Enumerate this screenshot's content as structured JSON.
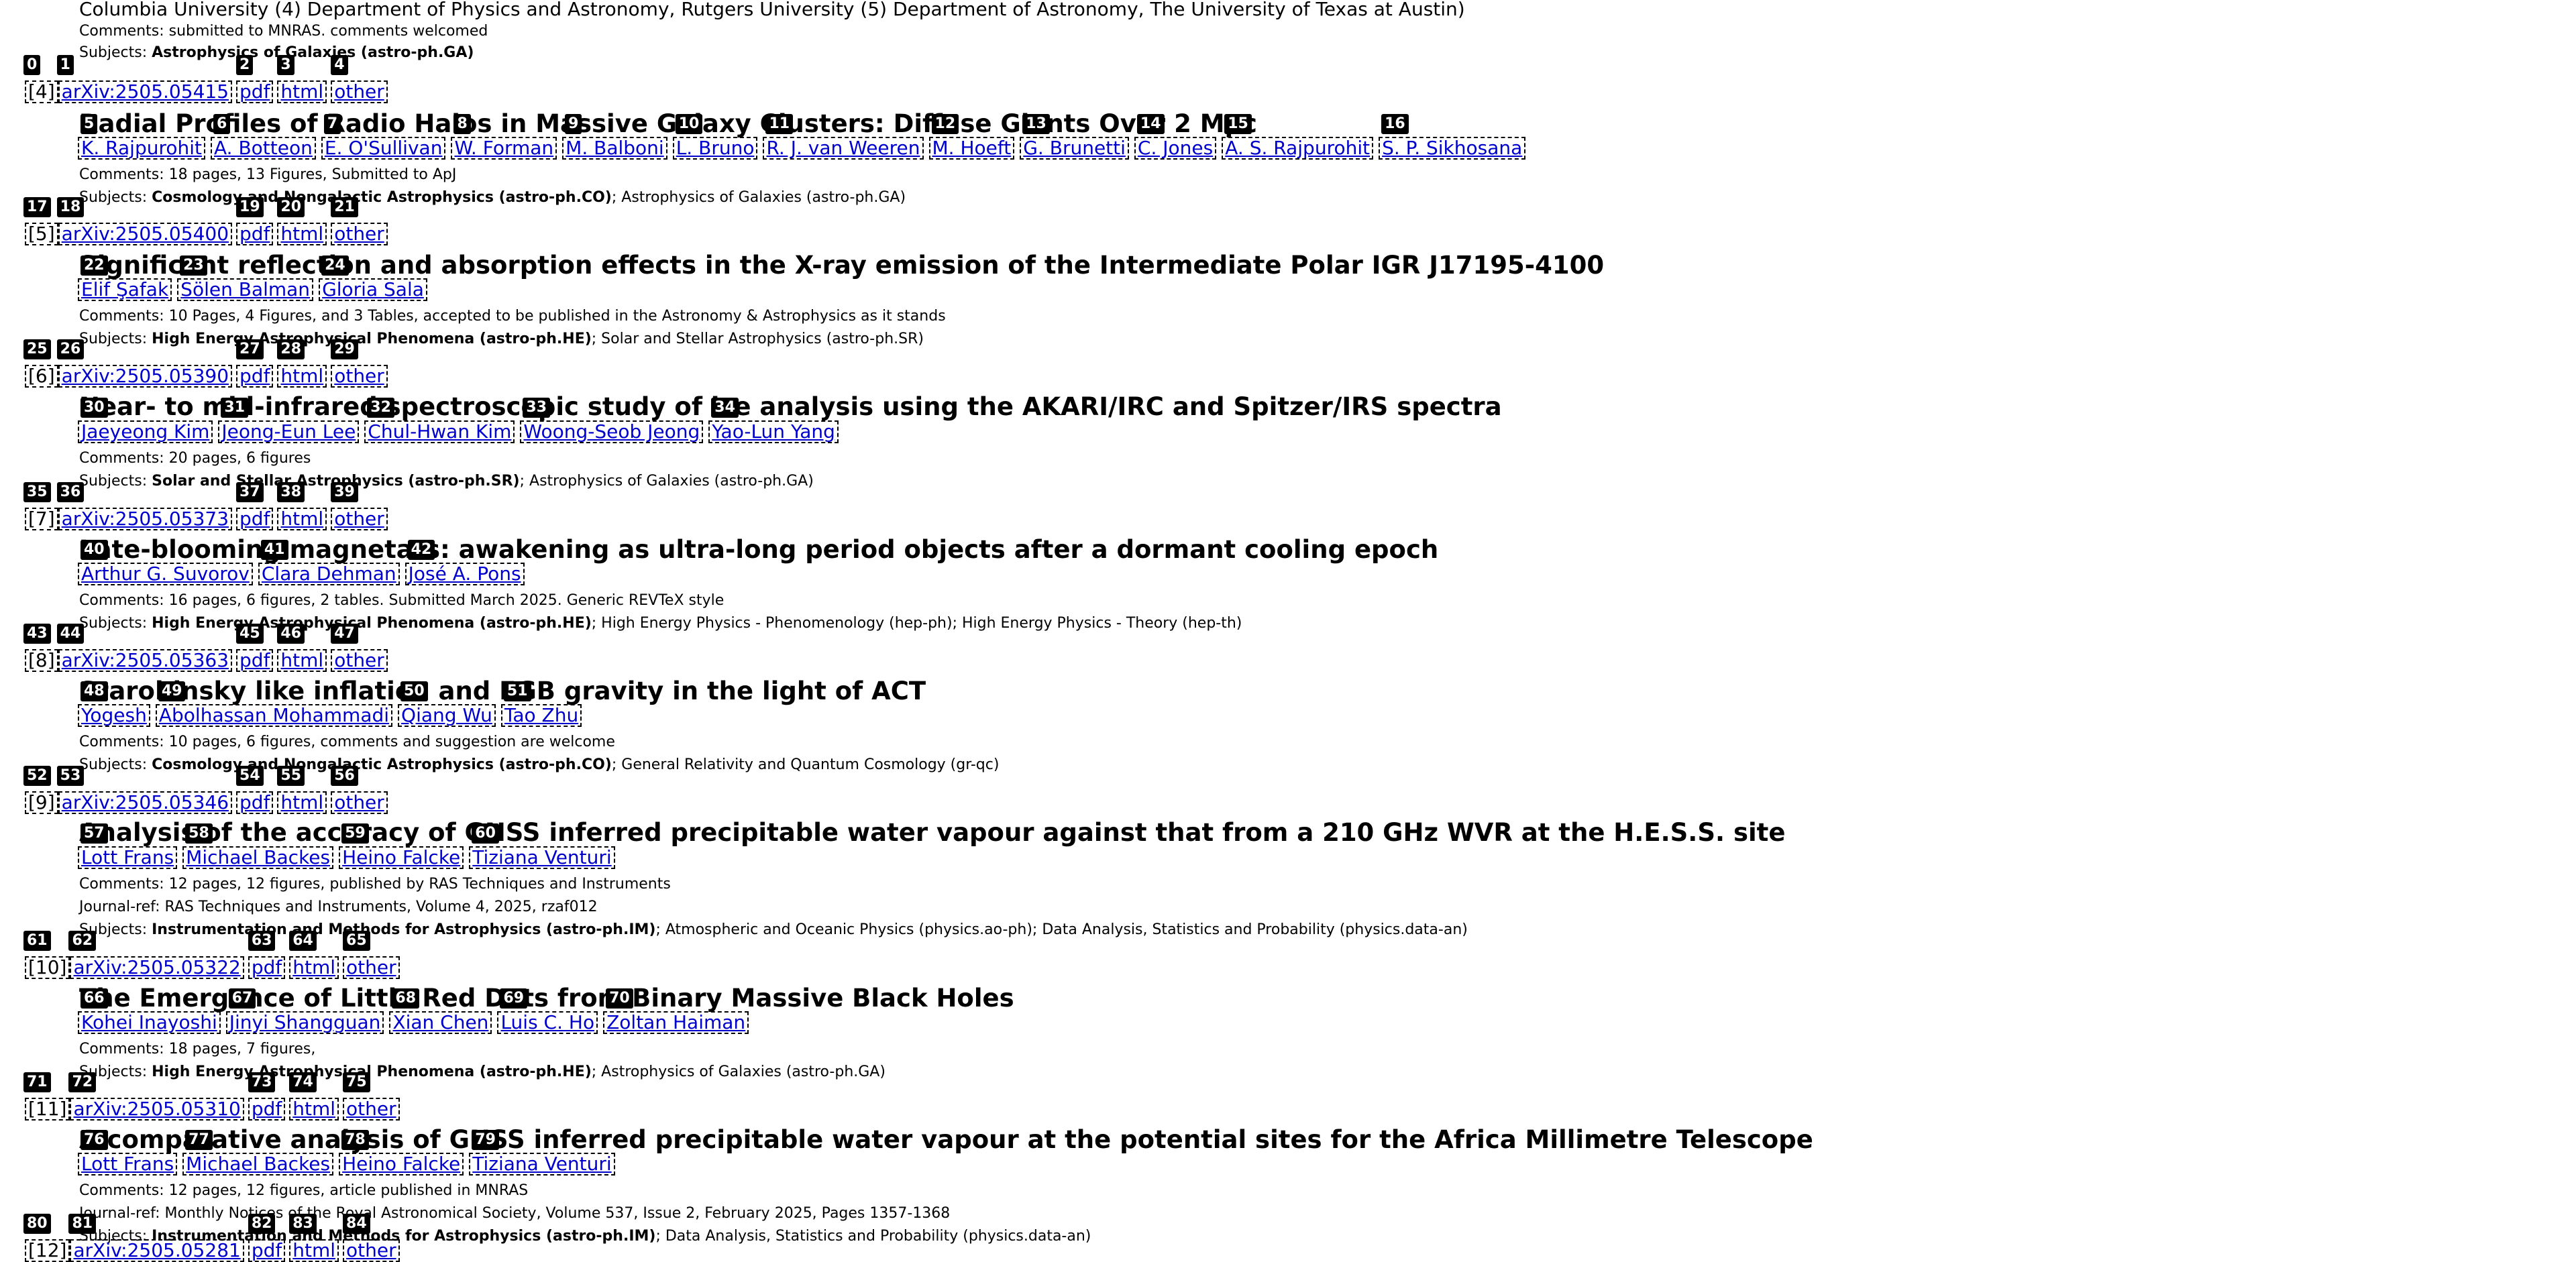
{
  "header_text": {
    "affiliations": "Columbia University (4) Department of Physics and Astronomy, Rutgers University (5) Department of Astronomy, The University of Texas at Austin)",
    "comments": "Comments: submitted to MNRAS. comments welcomed",
    "subjects_prefix": "Subjects: ",
    "subjects_primary": "Astrophysics of Galaxies (astro-ph.GA)"
  },
  "entries": [
    {
      "index": "[4]",
      "arxiv_id": "arXiv:2505.05415",
      "pdf": "pdf",
      "html": "html",
      "other": "other",
      "title": "Radial Profiles of Radio Halos in Massive Galaxy Clusters: Diffuse Giants Over 2 Mpc",
      "authors": [
        "K. Rajpurohit",
        "A. Botteon",
        "E. O'Sullivan",
        "W. Forman",
        "M. Balboni",
        "L. Bruno",
        "R. J. van Weeren",
        "M. Hoeft",
        "G. Brunetti",
        "C. Jones",
        "A. S. Rajpurohit",
        "S. P. Sikhosana"
      ],
      "comments": "Comments: 18 pages, 13 Figures, Submitted to ApJ",
      "subjects_primary": "Cosmology and Nongalactic Astrophysics (astro-ph.CO)",
      "subjects_rest": "; Astrophysics of Galaxies (astro-ph.GA)"
    },
    {
      "index": "[5]",
      "arxiv_id": "arXiv:2505.05400",
      "pdf": "pdf",
      "html": "html",
      "other": "other",
      "title": "Significant reflection and absorption effects in the X-ray emission of the Intermediate Polar IGR J17195-4100",
      "authors": [
        "Elif Şafak",
        "Sölen Balman",
        "Gloria Sala"
      ],
      "comments": "Comments: 10 Pages, 4 Figures, and 3 Tables, accepted to be published in the Astronomy & Astrophysics as it stands",
      "subjects_primary": "High Energy Astrophysical Phenomena (astro-ph.HE)",
      "subjects_rest": "; Solar and Stellar Astrophysics (astro-ph.SR)"
    },
    {
      "index": "[6]",
      "arxiv_id": "arXiv:2505.05390",
      "pdf": "pdf",
      "html": "html",
      "other": "other",
      "title": "Near- to mid-infrared spectroscopic study of ice analysis using the AKARI/IRC and Spitzer/IRS spectra",
      "authors": [
        "Jaeyeong Kim",
        "Jeong-Eun Lee",
        "Chul-Hwan Kim",
        "Woong-Seob Jeong",
        "Yao-Lun Yang"
      ],
      "comments": "Comments: 20 pages, 6 figures",
      "subjects_primary": "Solar and Stellar Astrophysics (astro-ph.SR)",
      "subjects_rest": "; Astrophysics of Galaxies (astro-ph.GA)"
    },
    {
      "index": "[7]",
      "arxiv_id": "arXiv:2505.05373",
      "pdf": "pdf",
      "html": "html",
      "other": "other",
      "title": "Late-blooming magnetars: awakening as ultra-long period objects after a dormant cooling epoch",
      "authors": [
        "Arthur G. Suvorov",
        "Clara Dehman",
        "José A. Pons"
      ],
      "comments": "Comments: 16 pages, 6 figures, 2 tables. Submitted March 2025. Generic REVTeX style",
      "subjects_primary": "High Energy Astrophysical Phenomena (astro-ph.HE)",
      "subjects_rest": "; High Energy Physics - Phenomenology (hep-ph); High Energy Physics - Theory (hep-th)"
    },
    {
      "index": "[8]",
      "arxiv_id": "arXiv:2505.05363",
      "pdf": "pdf",
      "html": "html",
      "other": "other",
      "title": "Starobinsky like inflation and EGB gravity in the light of ACT",
      "authors": [
        "Yogesh",
        "Abolhassan Mohammadi",
        "Qiang Wu",
        "Tao Zhu"
      ],
      "comments": "Comments: 10 pages, 6 figures, comments and suggestion are welcome",
      "subjects_primary": "Cosmology and Nongalactic Astrophysics (astro-ph.CO)",
      "subjects_rest": "; General Relativity and Quantum Cosmology (gr-qc)"
    },
    {
      "index": "[9]",
      "arxiv_id": "arXiv:2505.05346",
      "pdf": "pdf",
      "html": "html",
      "other": "other",
      "title": "Analysis of the accuracy of GNSS inferred precipitable water vapour against that from a 210 GHz WVR at the H.E.S.S. site",
      "authors": [
        "Lott Frans",
        "Michael Backes",
        "Heino Falcke",
        "Tiziana Venturi"
      ],
      "comments": "Comments: 12 pages, 12 figures, published by RAS Techniques and Instruments",
      "journal": "Journal-ref: RAS Techniques and Instruments, Volume 4, 2025, rzaf012",
      "subjects_primary": "Instrumentation and Methods for Astrophysics (astro-ph.IM)",
      "subjects_rest": "; Atmospheric and Oceanic Physics (physics.ao-ph); Data Analysis, Statistics and Probability (physics.data-an)"
    },
    {
      "index": "[10]",
      "arxiv_id": "arXiv:2505.05322",
      "pdf": "pdf",
      "html": "html",
      "other": "other",
      "title": "The Emergence of Little Red Dots from Binary Massive Black Holes",
      "authors": [
        "Kohei Inayoshi",
        "Jinyi Shangguan",
        "Xian Chen",
        "Luis C. Ho",
        "Zoltan Haiman"
      ],
      "comments": "Comments: 18 pages, 7 figures,",
      "subjects_primary": "High Energy Astrophysical Phenomena (astro-ph.HE)",
      "subjects_rest": "; Astrophysics of Galaxies (astro-ph.GA)"
    },
    {
      "index": "[11]",
      "arxiv_id": "arXiv:2505.05310",
      "pdf": "pdf",
      "html": "html",
      "other": "other",
      "title": "A comparative analysis of GNSS inferred precipitable water vapour at the potential sites for the Africa Millimetre Telescope",
      "authors": [
        "Lott Frans",
        "Michael Backes",
        "Heino Falcke",
        "Tiziana Venturi"
      ],
      "comments": "Comments: 12 pages, 12 figures, article published in MNRAS",
      "journal": "Journal-ref: Monthly Notices of the Royal Astronomical Society, Volume 537, Issue 2, February 2025, Pages 1357-1368",
      "subjects_primary": "Instrumentation and Methods for Astrophysics (astro-ph.IM)",
      "subjects_rest": "; Data Analysis, Statistics and Probability (physics.data-an)"
    },
    {
      "index": "[12]",
      "arxiv_id": "arXiv:2505.05281",
      "pdf": "pdf",
      "html": "html",
      "other": "other"
    }
  ],
  "tags": [
    "0",
    "1",
    "2",
    "3",
    "4",
    "5",
    "6",
    "7",
    "8",
    "9",
    "10",
    "11",
    "12",
    "13",
    "14",
    "15",
    "16",
    "17",
    "18",
    "19",
    "20",
    "21",
    "22",
    "23",
    "24",
    "25",
    "26",
    "27",
    "28",
    "29",
    "30",
    "31",
    "32",
    "33",
    "34",
    "35",
    "36",
    "37",
    "38",
    "39",
    "40",
    "41",
    "42",
    "43",
    "44",
    "45",
    "46",
    "47",
    "48",
    "49",
    "50",
    "51",
    "52",
    "53",
    "54",
    "55",
    "56",
    "57",
    "58",
    "59",
    "60",
    "61",
    "62",
    "63",
    "64",
    "65",
    "66",
    "67",
    "68",
    "69",
    "70",
    "71",
    "72",
    "73",
    "74",
    "75",
    "76",
    "77",
    "78",
    "79",
    "80",
    "81",
    "82",
    "83",
    "84"
  ]
}
